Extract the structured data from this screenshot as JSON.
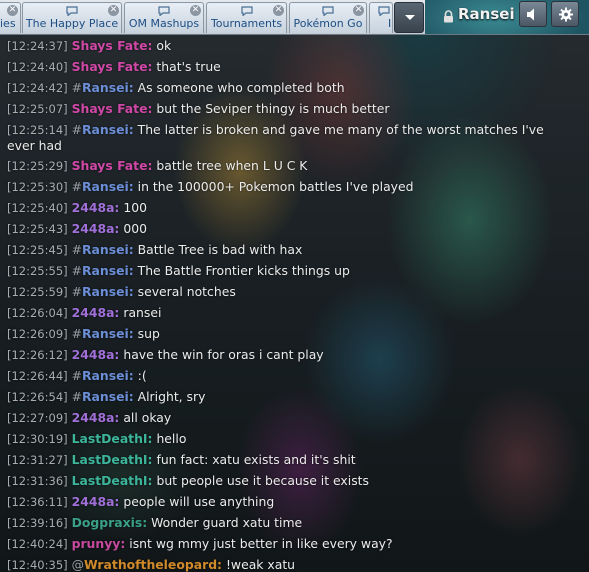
{
  "tabs": [
    {
      "label": "ies",
      "has_icon": false
    },
    {
      "label": "The Happy Place",
      "has_icon": true
    },
    {
      "label": "OM Mashups",
      "has_icon": true
    },
    {
      "label": "Tournaments",
      "has_icon": true
    },
    {
      "label": "Pokémon Go",
      "has_icon": true
    },
    {
      "label": "I",
      "has_icon": false
    }
  ],
  "user": {
    "name": "Ransei"
  },
  "icons": {
    "more": "chevron-down-icon",
    "lock": "lock-icon",
    "sound": "speaker-icon",
    "settings": "gear-icon"
  },
  "colors": {
    "shays": "#d048a6",
    "ransei": "#6c8ed6",
    "u2448a": "#a070d8",
    "lastdeath": "#3cb59a",
    "dogpraxis": "#3aa088",
    "prunyy": "#c64a9e",
    "wrath": "#d08a2a"
  },
  "messages": [
    {
      "time": "[12:24:37]",
      "rank": "",
      "user": "Shays Fate:",
      "color": "shays",
      "text": "ok"
    },
    {
      "time": "[12:24:40]",
      "rank": "",
      "user": "Shays Fate:",
      "color": "shays",
      "text": "that's true"
    },
    {
      "time": "[12:24:42]",
      "rank": "#",
      "user": "Ransei:",
      "color": "ransei",
      "text": "As someone who completed both"
    },
    {
      "time": "[12:25:07]",
      "rank": "",
      "user": "Shays Fate:",
      "color": "shays",
      "text": "but the Seviper thingy is much better"
    },
    {
      "time": "[12:25:14]",
      "rank": "#",
      "user": "Ransei:",
      "color": "ransei",
      "text": "The latter is broken and gave me many of the worst matches I've ever had"
    },
    {
      "time": "[12:25:29]",
      "rank": "",
      "user": "Shays Fate:",
      "color": "shays",
      "text": "battle tree when L U C K"
    },
    {
      "time": "[12:25:30]",
      "rank": "#",
      "user": "Ransei:",
      "color": "ransei",
      "text": "in the 100000+ Pokemon battles I've played"
    },
    {
      "time": "[12:25:40]",
      "rank": "",
      "user": "2448a:",
      "color": "u2448a",
      "text": "100"
    },
    {
      "time": "[12:25:43]",
      "rank": "",
      "user": "2448a:",
      "color": "u2448a",
      "text": "000"
    },
    {
      "time": "[12:25:45]",
      "rank": "#",
      "user": "Ransei:",
      "color": "ransei",
      "text": "Battle Tree is bad with hax"
    },
    {
      "time": "[12:25:55]",
      "rank": "#",
      "user": "Ransei:",
      "color": "ransei",
      "text": "The Battle Frontier kicks things up"
    },
    {
      "time": "[12:25:59]",
      "rank": "#",
      "user": "Ransei:",
      "color": "ransei",
      "text": "several notches"
    },
    {
      "time": "[12:26:04]",
      "rank": "",
      "user": "2448a:",
      "color": "u2448a",
      "text": "ransei"
    },
    {
      "time": "[12:26:09]",
      "rank": "#",
      "user": "Ransei:",
      "color": "ransei",
      "text": "sup"
    },
    {
      "time": "[12:26:12]",
      "rank": "",
      "user": "2448a:",
      "color": "u2448a",
      "text": "have the win for oras i cant play"
    },
    {
      "time": "[12:26:44]",
      "rank": "#",
      "user": "Ransei:",
      "color": "ransei",
      "text": ":("
    },
    {
      "time": "[12:26:54]",
      "rank": "#",
      "user": "Ransei:",
      "color": "ransei",
      "text": "Alright, sry"
    },
    {
      "time": "[12:27:09]",
      "rank": "",
      "user": "2448a:",
      "color": "u2448a",
      "text": "all okay"
    },
    {
      "time": "[12:30:19]",
      "rank": "",
      "user": "LastDeathI:",
      "color": "lastdeath",
      "text": "hello"
    },
    {
      "time": "[12:31:27]",
      "rank": "",
      "user": "LastDeathI:",
      "color": "lastdeath",
      "text": "fun fact: xatu exists and it's shit"
    },
    {
      "time": "[12:31:36]",
      "rank": "",
      "user": "LastDeathI:",
      "color": "lastdeath",
      "text": "but people use it because it exists"
    },
    {
      "time": "[12:36:11]",
      "rank": "",
      "user": "2448a:",
      "color": "u2448a",
      "text": "people will use anything"
    },
    {
      "time": "[12:39:16]",
      "rank": "",
      "user": "Dogpraxis:",
      "color": "dogpraxis",
      "text": "Wonder guard xatu time"
    },
    {
      "time": "[12:40:24]",
      "rank": "",
      "user": "prunyy:",
      "color": "prunyy",
      "text": "isnt wg mmy just better in like every way?"
    },
    {
      "time": "[12:40:35]",
      "rank": "@",
      "user": "Wrathoftheleopard:",
      "color": "wrath",
      "text": "!weak xatu"
    }
  ]
}
